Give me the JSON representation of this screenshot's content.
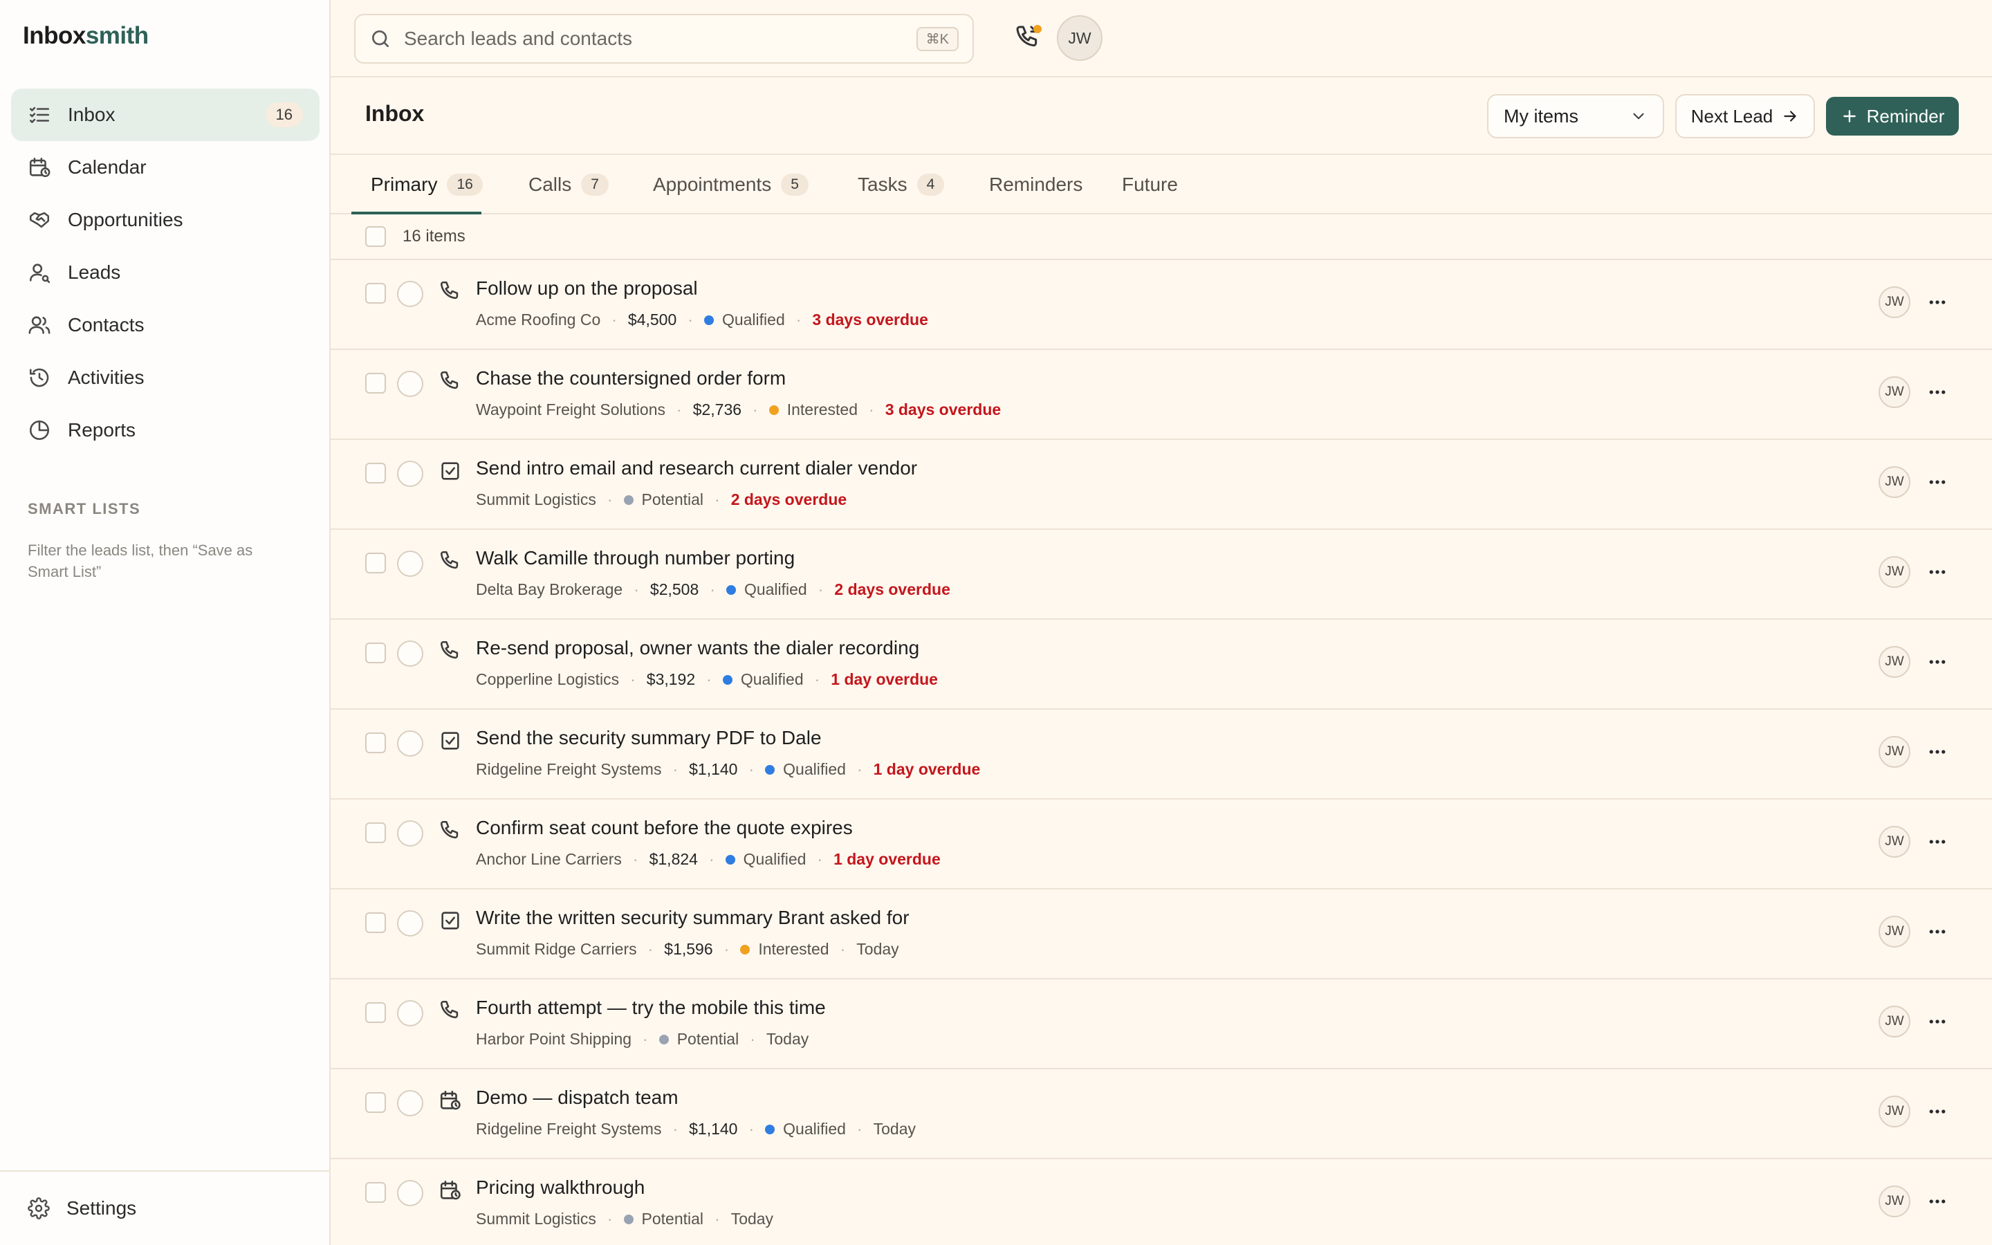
{
  "brand": {
    "part1": "Inbox",
    "part2": "smith"
  },
  "sidebar": {
    "items": [
      {
        "label": "Inbox",
        "badge": "16",
        "icon": "inbox-icon",
        "active": true
      },
      {
        "label": "Calendar",
        "icon": "calendar-icon"
      },
      {
        "label": "Opportunities",
        "icon": "handshake-icon"
      },
      {
        "label": "Leads",
        "icon": "lead-icon"
      },
      {
        "label": "Contacts",
        "icon": "contacts-icon"
      },
      {
        "label": "Activities",
        "icon": "history-icon"
      },
      {
        "label": "Reports",
        "icon": "pie-chart-icon"
      }
    ],
    "smart_lists_title": "SMART LISTS",
    "smart_lists_hint": "Filter the leads list, then “Save as Smart List”",
    "settings_label": "Settings"
  },
  "topbar": {
    "search_placeholder": "Search leads and contacts",
    "shortcut": "⌘K",
    "avatar": "JW"
  },
  "header": {
    "title": "Inbox",
    "filter_value": "My items",
    "next_lead_label": "Next Lead",
    "reminder_label": "Reminder"
  },
  "tabs": [
    {
      "label": "Primary",
      "count": "16",
      "active": true
    },
    {
      "label": "Calls",
      "count": "7"
    },
    {
      "label": "Appointments",
      "count": "5"
    },
    {
      "label": "Tasks",
      "count": "4"
    },
    {
      "label": "Reminders"
    },
    {
      "label": "Future"
    }
  ],
  "count_label": "16 items",
  "status_colors": {
    "Qualified": "#2f7de1",
    "Interested": "#f0a21f",
    "Potential": "#9aa3b2"
  },
  "rows": [
    {
      "type": "call",
      "title": "Follow up on the proposal",
      "company": "Acme Roofing Co",
      "amount": "$4,500",
      "status": "Qualified",
      "due": "3 days overdue",
      "overdue": true,
      "owner": "JW"
    },
    {
      "type": "call",
      "title": "Chase the countersigned order form",
      "company": "Waypoint Freight Solutions",
      "amount": "$2,736",
      "status": "Interested",
      "due": "3 days overdue",
      "overdue": true,
      "owner": "JW"
    },
    {
      "type": "task",
      "title": "Send intro email and research current dialer vendor",
      "company": "Summit Logistics",
      "amount": "",
      "status": "Potential",
      "due": "2 days overdue",
      "overdue": true,
      "owner": "JW"
    },
    {
      "type": "call",
      "title": "Walk Camille through number porting",
      "company": "Delta Bay Brokerage",
      "amount": "$2,508",
      "status": "Qualified",
      "due": "2 days overdue",
      "overdue": true,
      "owner": "JW"
    },
    {
      "type": "call",
      "title": "Re-send proposal, owner wants the dialer recording",
      "company": "Copperline Logistics",
      "amount": "$3,192",
      "status": "Qualified",
      "due": "1 day overdue",
      "overdue": true,
      "owner": "JW"
    },
    {
      "type": "task",
      "title": "Send the security summary PDF to Dale",
      "company": "Ridgeline Freight Systems",
      "amount": "$1,140",
      "status": "Qualified",
      "due": "1 day overdue",
      "overdue": true,
      "owner": "JW"
    },
    {
      "type": "call",
      "title": "Confirm seat count before the quote expires",
      "company": "Anchor Line Carriers",
      "amount": "$1,824",
      "status": "Qualified",
      "due": "1 day overdue",
      "overdue": true,
      "owner": "JW"
    },
    {
      "type": "task",
      "title": "Write the written security summary Brant asked for",
      "company": "Summit Ridge Carriers",
      "amount": "$1,596",
      "status": "Interested",
      "due": "Today",
      "overdue": false,
      "owner": "JW"
    },
    {
      "type": "call",
      "title": "Fourth attempt — try the mobile this time",
      "company": "Harbor Point Shipping",
      "amount": "",
      "status": "Potential",
      "due": "Today",
      "overdue": false,
      "owner": "JW"
    },
    {
      "type": "appointment",
      "title": "Demo — dispatch team",
      "company": "Ridgeline Freight Systems",
      "amount": "$1,140",
      "status": "Qualified",
      "due": "Today",
      "overdue": false,
      "owner": "JW"
    },
    {
      "type": "appointment",
      "title": "Pricing walkthrough",
      "company": "Summit Logistics",
      "amount": "",
      "status": "Potential",
      "due": "Today",
      "overdue": false,
      "owner": "JW"
    }
  ]
}
